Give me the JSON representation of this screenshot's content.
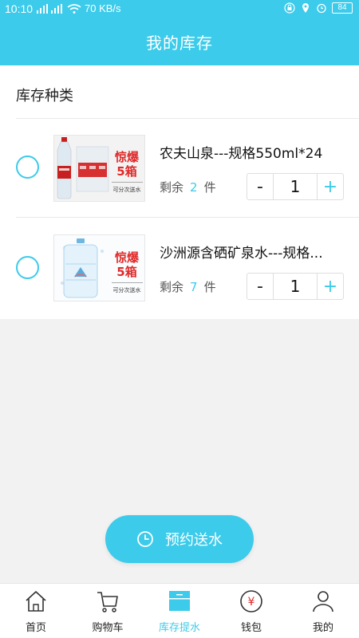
{
  "status_bar": {
    "time": "10:10",
    "network_speed": "70 KB/s",
    "battery": "84"
  },
  "header": {
    "title": "我的库存"
  },
  "section": {
    "title": "库存种类"
  },
  "items": [
    {
      "name": "农夫山泉---规格550ml*24",
      "remain_label": "剩余",
      "remain_count": "2",
      "unit": "件",
      "quantity": "1",
      "promo_main": "惊爆",
      "promo_sub": "5箱",
      "promo_note": "可分次送水",
      "icon": "water-bottle-pack"
    },
    {
      "name": "沙洲源含硒矿泉水---规格...",
      "remain_label": "剩余",
      "remain_count": "7",
      "unit": "件",
      "quantity": "1",
      "promo_main": "惊爆",
      "promo_sub": "5箱",
      "promo_note": "可分次送水",
      "icon": "water-bucket"
    }
  ],
  "stepper": {
    "minus": "-",
    "plus": "+"
  },
  "cta": {
    "label": "预约送水",
    "icon": "clock-icon"
  },
  "tabs": [
    {
      "label": "首页",
      "icon": "home-icon",
      "active": false
    },
    {
      "label": "购物车",
      "icon": "cart-icon",
      "active": false
    },
    {
      "label": "库存提水",
      "icon": "inventory-icon",
      "active": true
    },
    {
      "label": "钱包",
      "icon": "wallet-icon",
      "active": false
    },
    {
      "label": "我的",
      "icon": "user-icon",
      "active": false
    }
  ],
  "colors": {
    "accent": "#3ccbea",
    "promo_red": "#e02a2a",
    "background": "#f2f2f2"
  }
}
